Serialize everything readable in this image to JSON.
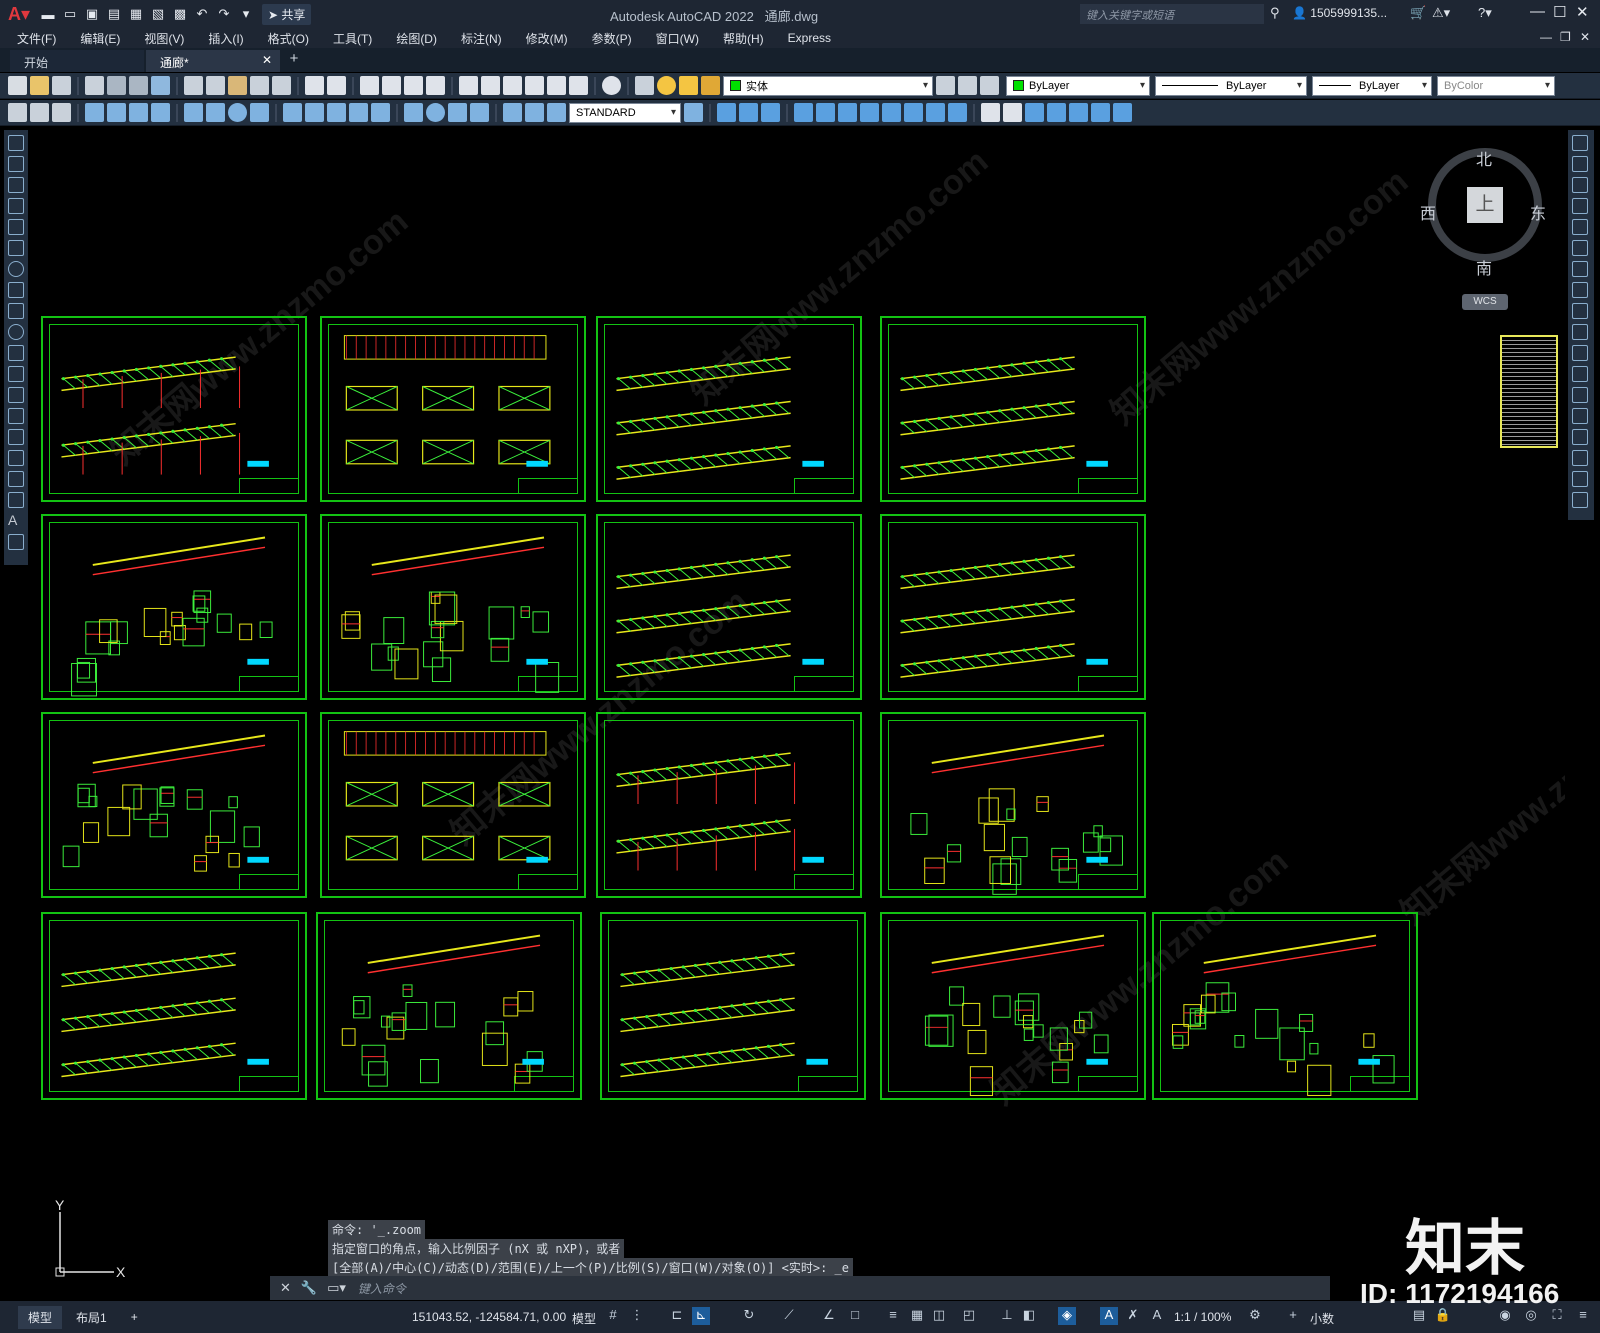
{
  "app": {
    "title": "Autodesk AutoCAD 2022",
    "filename": "通廊.dwg",
    "share_label": "共享",
    "search_placeholder": "键入关键字或短语",
    "user": "1505999135..."
  },
  "menu": [
    "文件(F)",
    "编辑(E)",
    "视图(V)",
    "插入(I)",
    "格式(O)",
    "工具(T)",
    "绘图(D)",
    "标注(N)",
    "修改(M)",
    "参数(P)",
    "窗口(W)",
    "帮助(H)",
    "Express"
  ],
  "tabs": [
    {
      "label": "开始"
    },
    {
      "label": "通廊*"
    }
  ],
  "toolbar": {
    "layer_name": "实体",
    "color": "ByLayer",
    "linetype": "ByLayer",
    "lineweight": "ByLayer",
    "plotstyle": "ByColor",
    "text_style": "STANDARD",
    "layer_swatch_color": "#00e000"
  },
  "viewcube": {
    "top": "上",
    "north": "北",
    "south": "南",
    "east": "东",
    "west": "西",
    "wcs": "WCS"
  },
  "command": {
    "history": [
      "命令: '_.zoom",
      "指定窗口的角点，输入比例因子 (nX 或 nXP)，或者",
      "[全部(A)/中心(C)/动态(D)/范围(E)/上一个(P)/比例(S)/窗口(W)/对象(O)] <实时>: _e"
    ],
    "prompt_placeholder": "键入命令"
  },
  "status": {
    "layout_tabs": [
      "模型",
      "布局1"
    ],
    "coordinates": "151043.52, -124584.71, 0.00",
    "space": "模型",
    "annotation_scale": "1:1 / 100%",
    "units": "小数"
  },
  "branding": {
    "logo": "知末",
    "id": "ID: 1172194166",
    "watermark": "知末网www.znzmo.com"
  },
  "colors": {
    "sheet_border": "#13c313",
    "drawing_yellow": "#e8e81a",
    "drawing_red": "#ff3030",
    "drawing_cyan": "#00d8ff"
  }
}
